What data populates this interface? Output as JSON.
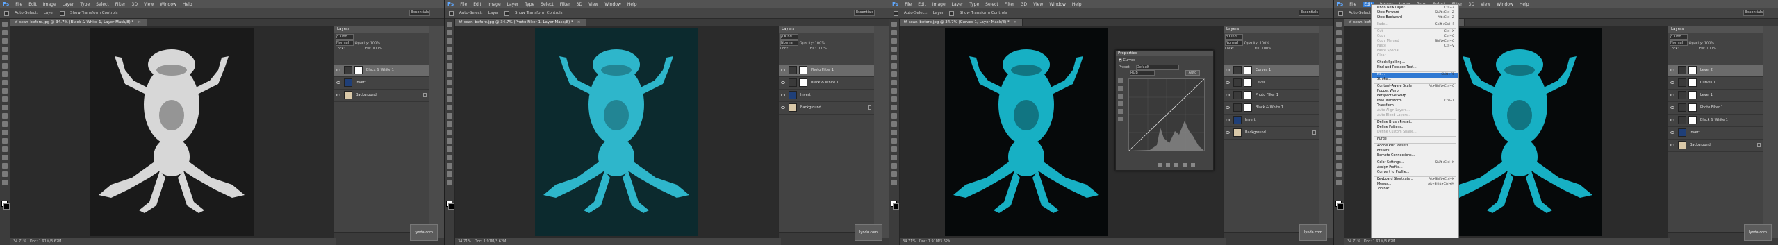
{
  "menubar": [
    "File",
    "Edit",
    "Image",
    "Layer",
    "Type",
    "Select",
    "Filter",
    "3D",
    "View",
    "Window",
    "Help"
  ],
  "menubar_logo": "Ps",
  "options": {
    "auto_select": "Auto-Select:",
    "auto_select_target": "Layer",
    "transform_controls": "Show Transform Controls",
    "workspace": "Essentials"
  },
  "panes": [
    {
      "doc_tab": "tf_scan_before.jpg @ 34.7% (Black & White 1, Layer Mask/8) *",
      "zoom": "34.71%",
      "doc": "Doc: 1.91M/3.62M",
      "layers": [
        {
          "name": "Black & White 1",
          "type": "adjustment",
          "selected": true
        },
        {
          "name": "Invert",
          "type": "adjustment",
          "selected": false
        },
        {
          "name": "Background",
          "type": "photo",
          "selected": false,
          "locked": true
        }
      ]
    },
    {
      "doc_tab": "tf_scan_before.jpg @ 34.7% (Photo Filter 1, Layer Mask/8) *",
      "zoom": "34.71%",
      "doc": "Doc: 1.91M/3.62M",
      "layers": [
        {
          "name": "Photo Filter 1",
          "type": "adjustment",
          "selected": true
        },
        {
          "name": "Black & White 1",
          "type": "adjustment",
          "selected": false
        },
        {
          "name": "Invert",
          "type": "blue",
          "selected": false
        },
        {
          "name": "Background",
          "type": "photo",
          "selected": false,
          "locked": true
        }
      ]
    },
    {
      "doc_tab": "tf_scan_before.jpg @ 34.7% (Curves 1, Layer Mask/8) *",
      "zoom": "34.71%",
      "doc": "Doc: 1.91M/3.62M",
      "layers": [
        {
          "name": "Curves 1",
          "type": "adjustment",
          "selected": true
        },
        {
          "name": "Level 1",
          "type": "adjustment",
          "selected": false
        },
        {
          "name": "Photo Filter 1",
          "type": "adjustment",
          "selected": false
        },
        {
          "name": "Black & White 1",
          "type": "adjustment",
          "selected": false
        },
        {
          "name": "Invert",
          "type": "blue",
          "selected": false
        },
        {
          "name": "Background",
          "type": "photo",
          "selected": false,
          "locked": true
        }
      ],
      "properties": {
        "title": "Properties",
        "section": "Curves",
        "preset_label": "Preset:",
        "preset": "Default",
        "channel": "RGB",
        "auto": "Auto"
      }
    },
    {
      "doc_tab": "tf_scan_before.jpg @ 34.7% (Level 2, Layer Mask/8) *",
      "zoom": "34.71%",
      "doc": "Doc: 1.91M/3.62M",
      "layers": [
        {
          "name": "Level 2",
          "type": "adjustment",
          "selected": true
        },
        {
          "name": "Curves 1",
          "type": "adjustment",
          "selected": false
        },
        {
          "name": "Level 1",
          "type": "adjustment",
          "selected": false
        },
        {
          "name": "Photo Filter 1",
          "type": "adjustment",
          "selected": false
        },
        {
          "name": "Black & White 1",
          "type": "adjustment",
          "selected": false
        },
        {
          "name": "Invert",
          "type": "blue",
          "selected": false
        },
        {
          "name": "Background",
          "type": "photo",
          "selected": false,
          "locked": true
        }
      ],
      "edit_menu": [
        {
          "label": "Undo New Layer",
          "sc": "Ctrl+Z"
        },
        {
          "label": "Step Forward",
          "sc": "Shift+Ctrl+Z"
        },
        {
          "label": "Step Backward",
          "sc": "Alt+Ctrl+Z"
        },
        {
          "sep": true
        },
        {
          "label": "Fade...",
          "sc": "Shift+Ctrl+F",
          "dis": true
        },
        {
          "sep": true
        },
        {
          "label": "Cut",
          "sc": "Ctrl+X",
          "dis": true
        },
        {
          "label": "Copy",
          "sc": "Ctrl+C",
          "dis": true
        },
        {
          "label": "Copy Merged",
          "sc": "Shift+Ctrl+C",
          "dis": true
        },
        {
          "label": "Paste",
          "sc": "Ctrl+V",
          "dis": true
        },
        {
          "label": "Paste Special",
          "sc": "",
          "dis": true
        },
        {
          "label": "Clear",
          "sc": "",
          "dis": true
        },
        {
          "sep": true
        },
        {
          "label": "Check Spelling...",
          "sc": ""
        },
        {
          "label": "Find and Replace Text...",
          "sc": ""
        },
        {
          "sep": true
        },
        {
          "label": "Fill...",
          "sc": "Shift+F5",
          "hl": true
        },
        {
          "label": "Stroke...",
          "sc": ""
        },
        {
          "sep": true
        },
        {
          "label": "Content-Aware Scale",
          "sc": "Alt+Shift+Ctrl+C"
        },
        {
          "label": "Puppet Warp",
          "sc": ""
        },
        {
          "label": "Perspective Warp",
          "sc": ""
        },
        {
          "label": "Free Transform",
          "sc": "Ctrl+T"
        },
        {
          "label": "Transform",
          "sc": ""
        },
        {
          "label": "Auto-Align Layers...",
          "sc": "",
          "dis": true
        },
        {
          "label": "Auto-Blend Layers...",
          "sc": "",
          "dis": true
        },
        {
          "sep": true
        },
        {
          "label": "Define Brush Preset...",
          "sc": ""
        },
        {
          "label": "Define Pattern...",
          "sc": ""
        },
        {
          "label": "Define Custom Shape...",
          "sc": "",
          "dis": true
        },
        {
          "sep": true
        },
        {
          "label": "Purge",
          "sc": ""
        },
        {
          "sep": true
        },
        {
          "label": "Adobe PDF Presets...",
          "sc": ""
        },
        {
          "label": "Presets",
          "sc": ""
        },
        {
          "label": "Remote Connections...",
          "sc": ""
        },
        {
          "sep": true
        },
        {
          "label": "Color Settings...",
          "sc": "Shift+Ctrl+K"
        },
        {
          "label": "Assign Profile...",
          "sc": ""
        },
        {
          "label": "Convert to Profile...",
          "sc": ""
        },
        {
          "sep": true
        },
        {
          "label": "Keyboard Shortcuts...",
          "sc": "Alt+Shift+Ctrl+K"
        },
        {
          "label": "Menus...",
          "sc": "Alt+Shift+Ctrl+M"
        },
        {
          "label": "Toolbar...",
          "sc": ""
        }
      ]
    }
  ],
  "layers_panel": {
    "tab": "Layers",
    "kind": "ρ Kind",
    "mode": "Normal",
    "opacity_label": "Opacity:",
    "opacity": "100%",
    "lock_label": "Lock:",
    "fill_label": "Fill:",
    "fill": "100%"
  },
  "watermark": "lynda.com",
  "colors": {
    "frog_gray": "#e8e8e8",
    "frog_cyan": "#32c6dc",
    "frog_cyan2": "#18b9cf",
    "bg_dark": "#1a1a1a",
    "bg_teal": "#0c2a2e",
    "bg_black": "#06090a"
  }
}
